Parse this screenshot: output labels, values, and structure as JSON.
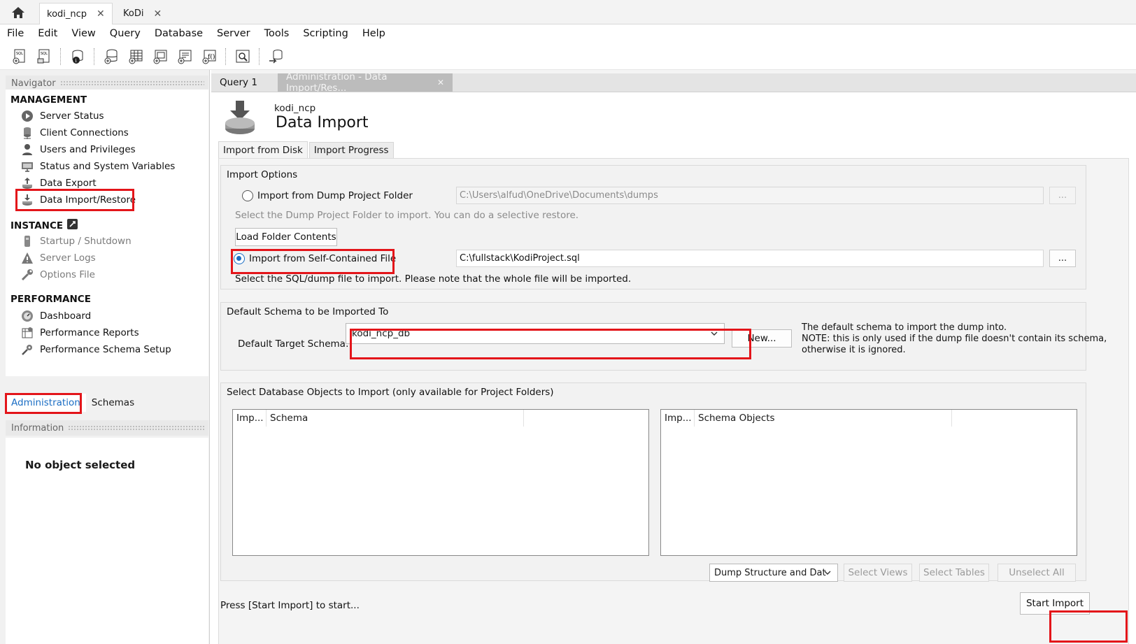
{
  "conn_tabs": [
    {
      "label": "kodi_ncp"
    },
    {
      "label": "KoDi"
    }
  ],
  "menu": [
    "File",
    "Edit",
    "View",
    "Query",
    "Database",
    "Server",
    "Tools",
    "Scripting",
    "Help"
  ],
  "toolbar_icons": [
    "new-sql-tab-icon",
    "open-sql-script-icon",
    "inspector-icon",
    "create-schema-icon",
    "create-table-icon",
    "create-view-icon",
    "create-procedure-icon",
    "create-function-icon",
    "search-table-data-icon",
    "reconnect-icon"
  ],
  "navigator": {
    "header": "Navigator",
    "management_title": "MANAGEMENT",
    "management": [
      {
        "label": "Server Status",
        "icon": "play-circle-icon"
      },
      {
        "label": "Client Connections",
        "icon": "connections-icon"
      },
      {
        "label": "Users and Privileges",
        "icon": "user-icon"
      },
      {
        "label": "Status and System Variables",
        "icon": "monitor-icon"
      },
      {
        "label": "Data Export",
        "icon": "export-icon"
      },
      {
        "label": "Data Import/Restore",
        "icon": "import-icon"
      }
    ],
    "instance_title": "INSTANCE",
    "instance": [
      {
        "label": "Startup / Shutdown",
        "icon": "power-icon"
      },
      {
        "label": "Server Logs",
        "icon": "warning-icon"
      },
      {
        "label": "Options File",
        "icon": "wrench-icon"
      }
    ],
    "performance_title": "PERFORMANCE",
    "performance": [
      {
        "label": "Dashboard",
        "icon": "dashboard-icon"
      },
      {
        "label": "Performance Reports",
        "icon": "reports-icon"
      },
      {
        "label": "Performance Schema Setup",
        "icon": "schema-setup-icon"
      }
    ],
    "tabs": [
      "Administration",
      "Schemas"
    ]
  },
  "information": {
    "header": "Information",
    "empty": "No object selected"
  },
  "doc_tabs": {
    "query": "Query 1",
    "admin": "Administration - Data Import/Res..."
  },
  "page": {
    "connection": "kodi_ncp",
    "title": "Data Import",
    "subtabs": [
      "Import from Disk",
      "Import Progress"
    ]
  },
  "import_options": {
    "title": "Import Options",
    "folder_label": "Import from Dump Project Folder",
    "folder_path": "C:\\Users\\alfud\\OneDrive\\Documents\\dumps",
    "folder_hint": "Select the Dump Project Folder to import. You can do a selective restore.",
    "load_folder": "Load Folder Contents",
    "file_label": "Import from Self-Contained File",
    "file_path": "C:\\fullstack\\KodiProject.sql",
    "file_hint": "Select the SQL/dump file to import. Please note that the whole file will be imported.",
    "browse": "...",
    "selected": "self-contained-file"
  },
  "schema": {
    "title": "Default Schema to be Imported To",
    "label": "Default Target Schema:",
    "value": "kodi_ncp_db",
    "new_btn": "New...",
    "note1": "The default schema to import the dump into.",
    "note2": "NOTE: this is only used if the dump file doesn't contain its schema,",
    "note3": "otherwise it is ignored."
  },
  "objects": {
    "title": "Select Database Objects to Import (only available for Project Folders)",
    "left_cols": [
      "Imp...",
      "Schema"
    ],
    "right_cols": [
      "Imp...",
      "Schema Objects"
    ],
    "dump_select": "Dump Structure and Dat",
    "select_views": "Select Views",
    "select_tables": "Select Tables",
    "unselect_all": "Unselect All"
  },
  "footer": {
    "status": "Press [Start Import] to start...",
    "start": "Start Import"
  },
  "colors": {
    "highlight": "#e3151a",
    "accent": "#1a6dc4"
  }
}
